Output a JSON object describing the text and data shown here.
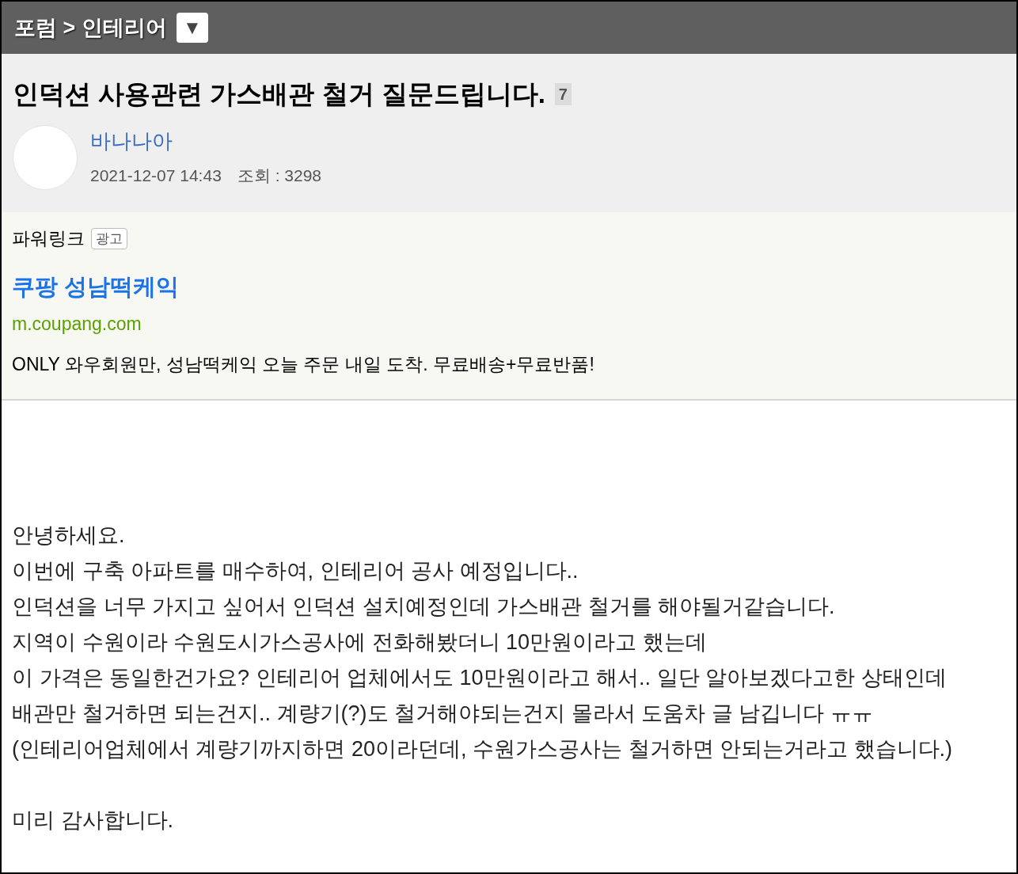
{
  "breadcrumb": {
    "text": "포럼 > 인테리어",
    "dropdown": "▼"
  },
  "post": {
    "title": "인덕션 사용관련 가스배관 철거 질문드립니다.",
    "comment_count": "7",
    "author": "바나나아",
    "date": "2021-12-07 14:43",
    "views": "조회 : 3298"
  },
  "ad": {
    "label": "파워링크",
    "badge": "광고",
    "headline": "쿠팡 성남떡케익",
    "url": "m.coupang.com",
    "description": "ONLY 와우회원만, 성남떡케익 오늘 주문 내일 도착. 무료배송+무료반품!"
  },
  "body": [
    "안녕하세요.",
    "이번에 구축 아파트를 매수하여, 인테리어 공사 예정입니다..",
    "인덕션을 너무 가지고 싶어서 인덕션 설치예정인데 가스배관 철거를 해야될거같습니다.",
    "지역이 수원이라 수원도시가스공사에 전화해봤더니 10만원이라고 했는데",
    "이 가격은 동일한건가요? 인테리어 업체에서도 10만원이라고 해서.. 일단 알아보겠다고한 상태인데",
    "배관만 철거하면 되는건지.. 계량기(?)도 철거해야되는건지 몰라서 도움차 글 남깁니다 ㅠㅠ",
    "(인테리어업체에서 계량기까지하면 20이라던데, 수원가스공사는 철거하면 안되는거라고 했습니다.)",
    "미리 감사합니다."
  ]
}
